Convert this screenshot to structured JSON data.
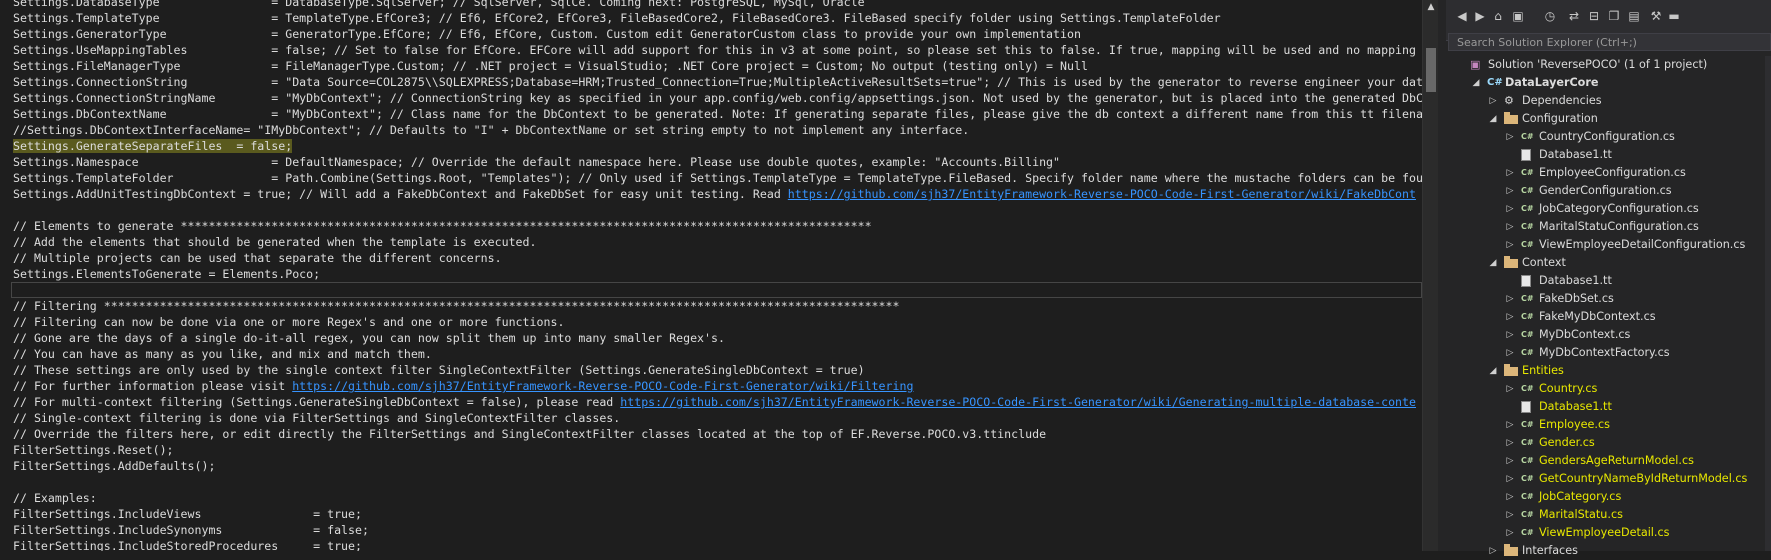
{
  "editor": {
    "lines": [
      [
        {
          "t": "Settings.DatabaseType                = DatabaseType.SqlServer; // SqlServer, SqlCe. Coming next: PostgreSQL, MySql, Oracle"
        }
      ],
      [
        {
          "t": "Settings.TemplateType                = TemplateType.EfCore3; // Ef6, EfCore2, EfCore3, FileBasedCore2, FileBasedCore3. FileBased specify folder using Settings.TemplateFolder"
        }
      ],
      [
        {
          "t": "Settings.GeneratorType               = GeneratorType.EfCore; // Ef6, EfCore, Custom. Custom edit GeneratorCustom class to provide your own implementation"
        }
      ],
      [
        {
          "t": "Settings.UseMappingTables            = false; // Set to false for EfCore. EFCore will add support for this in v3 at some point, so please set this to false. If true, mapping will be used and no mapping tab"
        }
      ],
      [
        {
          "t": "Settings.FileManagerType             = FileManagerType.Custom; // .NET project = VisualStudio; .NET Core project = Custom; No output (testing only) = Null"
        }
      ],
      [
        {
          "t": "Settings.ConnectionString            = \"Data Source=COL2875\\\\SQLEXPRESS;Database=HRM;Trusted_Connection=True;MultipleActiveResultSets=true\"; // This is used by the generator to reverse engineer your databa"
        }
      ],
      [
        {
          "t": "Settings.ConnectionStringName        = \"MyDbContext\"; // ConnectionString key as specified in your app.config/web.config/appsettings.json. Not used by the generator, but is placed into the generated DbCont"
        }
      ],
      [
        {
          "t": "Settings.DbContextName               = \"MyDbContext\"; // Class name for the DbContext to be generated. Note: If generating separate files, please give the db context a different name from this tt filename."
        }
      ],
      [
        {
          "t": "//Settings.DbContextInterfaceName= \"IMyDbContext\"; // Defaults to \"I\" + DbContextName or set string empty to not implement any interface."
        }
      ],
      [
        {
          "t": "Settings.GenerateSeparateFiles  = false;",
          "hl": true
        }
      ],
      [
        {
          "t": "Settings.Namespace                   = DefaultNamespace; // Override the default namespace here. Please use double quotes, example: \"Accounts.Billing\""
        }
      ],
      [
        {
          "t": "Settings.TemplateFolder              = Path.Combine(Settings.Root, \"Templates\"); // Only used if Settings.TemplateType = TemplateType.FileBased. Specify folder name where the mustache folders can be found."
        }
      ],
      [
        {
          "t": "Settings.AddUnitTestingDbContext = true; // Will add a FakeDbContext and FakeDbSet for easy unit testing. Read "
        },
        {
          "t": "https://github.com/sjh37/EntityFramework-Reverse-POCO-Code-First-Generator/wiki/FakeDbCont",
          "link": true
        }
      ],
      [
        {
          "t": ""
        }
      ],
      [
        {
          "t": "// Elements to generate ***************************************************************************************************"
        }
      ],
      [
        {
          "t": "// Add the elements that should be generated when the template is executed."
        }
      ],
      [
        {
          "t": "// Multiple projects can be used that separate the different concerns."
        }
      ],
      [
        {
          "t": "Settings.ElementsToGenerate = Elements.Poco;"
        }
      ],
      [
        {
          "t": "",
          "cursor": true
        }
      ],
      [
        {
          "t": "// Filtering ******************************************************************************************************************"
        }
      ],
      [
        {
          "t": "// Filtering can now be done via one or more Regex's and one or more functions."
        }
      ],
      [
        {
          "t": "// Gone are the days of a single do-it-all regex, you can now split them up into many smaller Regex's."
        }
      ],
      [
        {
          "t": "// You can have as many as you like, and mix and match them."
        }
      ],
      [
        {
          "t": "// These settings are only used by the single context filter SingleContextFilter (Settings.GenerateSingleDbContext = true)"
        }
      ],
      [
        {
          "t": "// For further information please visit "
        },
        {
          "t": "https://github.com/sjh37/EntityFramework-Reverse-POCO-Code-First-Generator/wiki/Filtering",
          "link": true
        }
      ],
      [
        {
          "t": "// For multi-context filtering (Settings.GenerateSingleDbContext = false), please read "
        },
        {
          "t": "https://github.com/sjh37/EntityFramework-Reverse-POCO-Code-First-Generator/wiki/Generating-multiple-database-conte",
          "link": true
        }
      ],
      [
        {
          "t": "// Single-context filtering is done via FilterSettings and SingleContextFilter classes."
        }
      ],
      [
        {
          "t": "// Override the filters here, or edit directly the FilterSettings and SingleContextFilter classes located at the top of EF.Reverse.POCO.v3.ttinclude"
        }
      ],
      [
        {
          "t": "FilterSettings.Reset();"
        }
      ],
      [
        {
          "t": "FilterSettings.AddDefaults();"
        }
      ],
      [
        {
          "t": ""
        }
      ],
      [
        {
          "t": "// Examples:"
        }
      ],
      [
        {
          "t": "FilterSettings.IncludeViews                = true;"
        }
      ],
      [
        {
          "t": "FilterSettings.IncludeSynonyms             = false;"
        }
      ],
      [
        {
          "t": "FilterSettings.IncludeStoredProcedures     = true;"
        }
      ]
    ]
  },
  "solution_explorer": {
    "search_placeholder": "Search Solution Explorer (Ctrl+;)",
    "toolbar_icons": [
      "back-icon",
      "forward-icon",
      "home-icon",
      "switch-views-icon",
      "pending-changes-icon",
      "sync-icon",
      "collapse-all-icon",
      "copy-icon",
      "show-all-files-icon",
      "properties-icon",
      "preview-icon"
    ],
    "tree": [
      {
        "label": "Solution 'ReversePOCO' (1 of 1 project)",
        "indent": 0,
        "icon": "sol",
        "exp": "",
        "name": "solution-node"
      },
      {
        "label": "DataLayerCore",
        "indent": 1,
        "icon": "proj",
        "exp": "open",
        "bold": true,
        "name": "project-node"
      },
      {
        "label": "Dependencies",
        "indent": 2,
        "icon": "dep",
        "exp": "closed",
        "name": "dependencies-node"
      },
      {
        "label": "Configuration",
        "indent": 2,
        "icon": "folder",
        "exp": "open",
        "name": "configuration-folder"
      },
      {
        "label": "CountryConfiguration.cs",
        "indent": 3,
        "icon": "csharp",
        "exp": "closed",
        "name": "file-node"
      },
      {
        "label": "Database1.tt",
        "indent": 3,
        "icon": "file",
        "exp": "",
        "name": "file-node"
      },
      {
        "label": "EmployeeConfiguration.cs",
        "indent": 3,
        "icon": "csharp",
        "exp": "closed",
        "name": "file-node"
      },
      {
        "label": "GenderConfiguration.cs",
        "indent": 3,
        "icon": "csharp",
        "exp": "closed",
        "name": "file-node"
      },
      {
        "label": "JobCategoryConfiguration.cs",
        "indent": 3,
        "icon": "csharp",
        "exp": "closed",
        "name": "file-node"
      },
      {
        "label": "MaritalStatuConfiguration.cs",
        "indent": 3,
        "icon": "csharp",
        "exp": "closed",
        "name": "file-node"
      },
      {
        "label": "ViewEmployeeDetailConfiguration.cs",
        "indent": 3,
        "icon": "csharp",
        "exp": "closed",
        "name": "file-node"
      },
      {
        "label": "Context",
        "indent": 2,
        "icon": "folder",
        "exp": "open",
        "name": "context-folder"
      },
      {
        "label": "Database1.tt",
        "indent": 3,
        "icon": "file",
        "exp": "",
        "name": "file-node"
      },
      {
        "label": "FakeDbSet.cs",
        "indent": 3,
        "icon": "csharp",
        "exp": "closed",
        "name": "file-node"
      },
      {
        "label": "FakeMyDbContext.cs",
        "indent": 3,
        "icon": "csharp",
        "exp": "closed",
        "name": "file-node"
      },
      {
        "label": "MyDbContext.cs",
        "indent": 3,
        "icon": "csharp",
        "exp": "closed",
        "name": "file-node"
      },
      {
        "label": "MyDbContextFactory.cs",
        "indent": 3,
        "icon": "csharp",
        "exp": "closed",
        "name": "file-node"
      },
      {
        "label": "Entities",
        "indent": 2,
        "icon": "folder",
        "exp": "open",
        "mark": true,
        "name": "entities-folder"
      },
      {
        "label": "Country.cs",
        "indent": 3,
        "icon": "csharp",
        "exp": "closed",
        "mark": true,
        "name": "file-node"
      },
      {
        "label": "Database1.tt",
        "indent": 3,
        "icon": "file",
        "exp": "",
        "mark": true,
        "name": "file-node"
      },
      {
        "label": "Employee.cs",
        "indent": 3,
        "icon": "csharp",
        "exp": "closed",
        "mark": true,
        "name": "file-node"
      },
      {
        "label": "Gender.cs",
        "indent": 3,
        "icon": "csharp",
        "exp": "closed",
        "mark": true,
        "name": "file-node"
      },
      {
        "label": "GendersAgeReturnModel.cs",
        "indent": 3,
        "icon": "csharp",
        "exp": "closed",
        "mark": true,
        "name": "file-node"
      },
      {
        "label": "GetCountryNameByIdReturnModel.cs",
        "indent": 3,
        "icon": "csharp",
        "exp": "closed",
        "mark": true,
        "name": "file-node"
      },
      {
        "label": "JobCategory.cs",
        "indent": 3,
        "icon": "csharp",
        "exp": "closed",
        "mark": true,
        "name": "file-node"
      },
      {
        "label": "MaritalStatu.cs",
        "indent": 3,
        "icon": "csharp",
        "exp": "closed",
        "mark": true,
        "name": "file-node"
      },
      {
        "label": "ViewEmployeeDetail.cs",
        "indent": 3,
        "icon": "csharp",
        "exp": "closed",
        "mark": true,
        "name": "file-node"
      },
      {
        "label": "Interfaces",
        "indent": 2,
        "icon": "folder",
        "exp": "closed",
        "name": "interfaces-folder"
      }
    ]
  }
}
